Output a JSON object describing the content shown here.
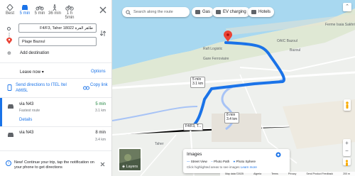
{
  "modes": [
    {
      "name": "best",
      "label": "Best",
      "active": false
    },
    {
      "name": "car",
      "label": "5 min",
      "active": true
    },
    {
      "name": "motorcycle",
      "label": "5 min",
      "active": false
    },
    {
      "name": "walk",
      "label": "36 min",
      "active": false
    },
    {
      "name": "bike",
      "label": "1 h 5min",
      "active": false
    }
  ],
  "origin_value": "F4/F3, Taher 18022 طاهر الفرة",
  "destination_value": "Plage Bazoul",
  "add_destination": "Add destination",
  "leave_now": "Leave now",
  "options": "Options",
  "send_directions": "Send directions to ITEL Itel A665L",
  "copy_link": "Copy link",
  "routes": [
    {
      "via": "via N43",
      "sub": "Fastest route",
      "time": "5 min",
      "dist": "3.1 km",
      "details": "Details"
    },
    {
      "via": "via N43",
      "sub": "",
      "time": "8 min",
      "dist": "3.4 km"
    }
  ],
  "notice": "New! Continue your trip, tap the notification on your phone to get directions",
  "map": {
    "search_placeholder": "Search along the route",
    "chips": [
      "Gas",
      "EV charging",
      "Hotels"
    ],
    "labels": {
      "rafi": "Rafi Logistic",
      "oaic": "OAIC Bazoul",
      "gare": "Gare Ferroviaire",
      "ferme": "Ferme Isaia Sakhri",
      "bazoul": "Bazoul",
      "taher": "Taher",
      "f4": "F4/F3, T..."
    },
    "bubble1": {
      "time": "5 min",
      "dist": "3.1 km"
    },
    "bubble2": {
      "time": "8 min",
      "dist": "3.4 km"
    },
    "layers": "Layers",
    "images": {
      "title": "Images",
      "items": [
        "Street View",
        "Photo Path",
        "Photo Sphere"
      ],
      "hint": "Click highlighted areas to see images",
      "learn": "Learn more"
    },
    "attribution": [
      "Map data ©2025",
      "Algeria",
      "Terms",
      "Privacy",
      "Send Product Feedback",
      "200 m"
    ]
  },
  "colors": {
    "route": "#1a73e8",
    "alt_route": "#a7c3f6",
    "dest": "#ea4335"
  }
}
